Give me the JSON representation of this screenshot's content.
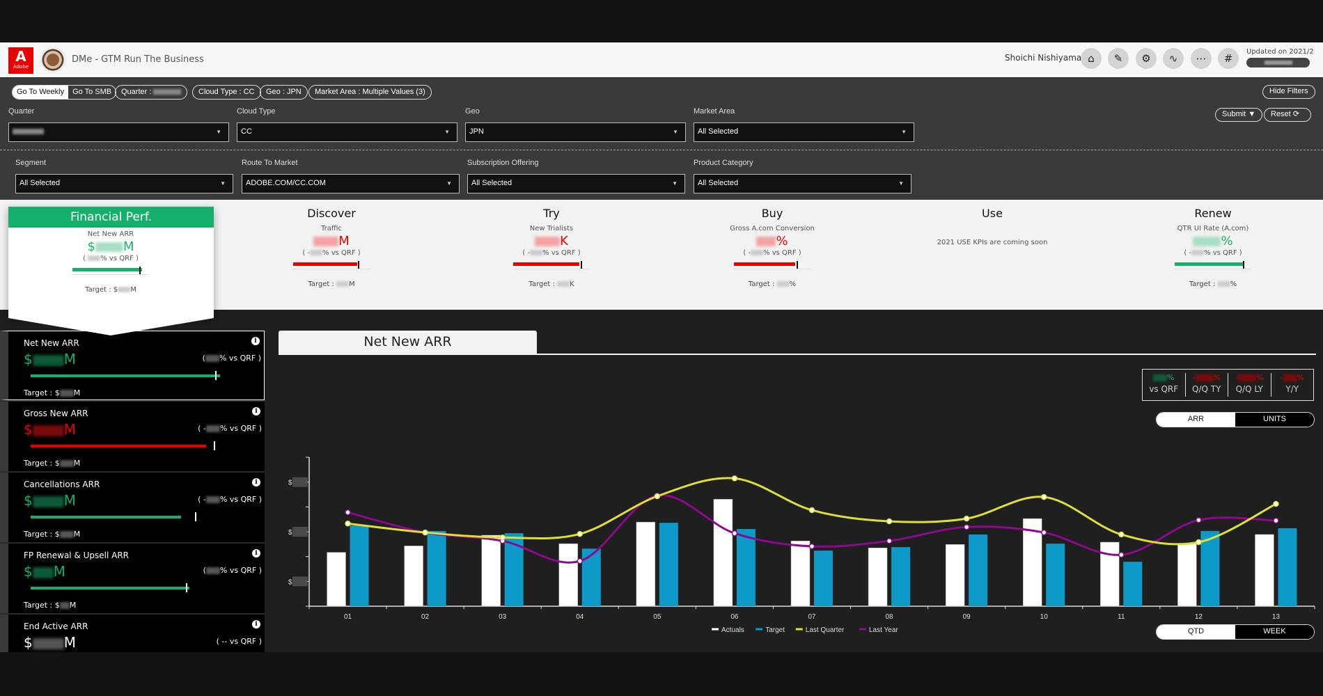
{
  "header": {
    "logo_label": "Adobe",
    "app_title": "DMe - GTM Run The Business",
    "user_name": "Shoichi Nishiyama",
    "icons": [
      "home-icon",
      "edit-icon",
      "filter-settings-icon",
      "pulse-icon",
      "workflow-icon",
      "slack-icon"
    ],
    "updated_label": "Updated on 2021/2"
  },
  "filters": {
    "chips": {
      "weekly": "Go To Weekly",
      "smb": "Go To SMB",
      "quarter": "Quarter : ",
      "cloud_type": "Cloud Type : CC",
      "geo": "Geo : JPN",
      "market_area": "Market Area : Multiple Values (3)"
    },
    "hide_filters": "Hide Filters",
    "submit": "Submit",
    "reset": "Reset",
    "row1": [
      {
        "label": "Quarter",
        "value": ""
      },
      {
        "label": "Cloud Type",
        "value": "CC"
      },
      {
        "label": "Geo",
        "value": "JPN"
      },
      {
        "label": "Market Area",
        "value": "All Selected"
      }
    ],
    "row2": [
      {
        "label": "Segment",
        "value": "All Selected"
      },
      {
        "label": "Route To Market",
        "value": "ADOBE.COM/CC.COM"
      },
      {
        "label": "Subscription Offering",
        "value": "All Selected"
      },
      {
        "label": "Product Category",
        "value": "All Selected"
      }
    ]
  },
  "kpis": {
    "financial": {
      "title": "Financial Perf.",
      "metric": "Net New ARR",
      "prefix": "$",
      "suffix": "M",
      "vs_prefix": "(",
      "vs_suffix": "% vs QRF )",
      "target_prefix": "Target : $",
      "target_suffix": "M",
      "progress": 0.97,
      "status": "good"
    },
    "discover": {
      "title": "Discover",
      "metric": "Traffic",
      "prefix": "",
      "suffix": "M",
      "vs_prefix": "( -",
      "vs_suffix": "% vs QRF )",
      "target_prefix": "Target : ",
      "target_suffix": "M",
      "progress": 0.93,
      "status": "bad"
    },
    "try": {
      "title": "Try",
      "metric": "New Trialists",
      "prefix": "",
      "suffix": "K",
      "vs_prefix": "( -",
      "vs_suffix": "% vs QRF )",
      "target_prefix": "Target : ",
      "target_suffix": "K",
      "progress": 0.95,
      "status": "bad"
    },
    "buy": {
      "title": "Buy",
      "metric": "Gross A.com Conversion",
      "prefix": "",
      "suffix": "%",
      "vs_prefix": "( -",
      "vs_suffix": "% vs QRF )",
      "target_prefix": "Target : ",
      "target_suffix": "%",
      "progress": 0.97,
      "status": "bad"
    },
    "use": {
      "title": "Use",
      "message": "2021 USE KPIs are coming soon"
    },
    "renew": {
      "title": "Renew",
      "metric": "QTR UI Rate (A.com)",
      "prefix": "",
      "suffix": "%",
      "vs_prefix": "( -",
      "vs_suffix": "% vs QRF )",
      "target_prefix": "Target : ",
      "target_suffix": "%",
      "progress": 1.0,
      "status": "good"
    }
  },
  "metrics": [
    {
      "title": "Net New ARR",
      "prefix": "$",
      "suffix": "M",
      "vs": "% vs QRF )",
      "vs_prefix": "(",
      "target": "Target : $",
      "target_suffix": "M",
      "status": "good",
      "progress": 1.0,
      "target_mark": 0.97,
      "active": true
    },
    {
      "title": "Gross New ARR",
      "prefix": "$",
      "suffix": "M",
      "vs": "% vs QRF )",
      "vs_prefix": "( -",
      "target": "Target : $",
      "target_suffix": "M",
      "status": "bad",
      "progress": 0.95,
      "target_mark": 1.0,
      "active": false
    },
    {
      "title": "Cancellations ARR",
      "prefix": "$",
      "suffix": "M",
      "vs": "% vs QRF )",
      "vs_prefix": "( -",
      "target": "Target : $",
      "target_suffix": "M",
      "status": "good",
      "progress": 0.92,
      "target_mark": 1.0,
      "active": false
    },
    {
      "title": "FP Renewal & Upsell ARR",
      "prefix": "$",
      "suffix": "M",
      "vs": "% vs QRF )",
      "vs_prefix": "(",
      "target": "Target : $",
      "target_suffix": "M",
      "status": "good",
      "progress": 1.0,
      "target_mark": 0.97,
      "active": false
    },
    {
      "title": "End Active ARR",
      "prefix": "$",
      "suffix": "M",
      "vs": "( -- vs QRF )",
      "vs_prefix": "",
      "target": "",
      "target_suffix": "",
      "status": "neutral",
      "active": false
    }
  ],
  "chart_panel": {
    "tab_title": "Net New ARR",
    "stats": [
      {
        "value_suffix": "%",
        "label": "vs QRF",
        "status": "good"
      },
      {
        "value_suffix": "%",
        "label": "Q/Q TY",
        "status": "bad"
      },
      {
        "value_suffix": "%",
        "label": "Q/Q LY",
        "status": "bad"
      },
      {
        "value_suffix": "%",
        "label": "Y/Y",
        "status": "bad"
      }
    ],
    "unit_toggle": {
      "options": [
        "ARR",
        "UNITS"
      ],
      "selected": "ARR"
    },
    "period_toggle": {
      "options": [
        "QTD",
        "WEEK"
      ],
      "selected": "QTD"
    }
  },
  "colors": {
    "good": "#16b06c",
    "bad": "#e60000",
    "actuals": "#ffffff",
    "target": "#0e9ac8",
    "last_quarter": "#e0e032",
    "last_year": "#8b0a8b"
  },
  "chart_data": {
    "type": "bar",
    "title": "Net New ARR",
    "xlabel": "",
    "ylabel": "",
    "y_tick_labels_obscured": true,
    "ylim": [
      0,
      6
    ],
    "categories": [
      "01",
      "02",
      "03",
      "04",
      "05",
      "06",
      "07",
      "08",
      "09",
      "10",
      "11",
      "12",
      "13"
    ],
    "series": [
      {
        "name": "Actuals",
        "type": "bar",
        "values": [
          2.17,
          2.43,
          2.86,
          2.52,
          3.39,
          4.31,
          2.63,
          2.35,
          2.49,
          3.53,
          2.58,
          2.52,
          2.89
        ]
      },
      {
        "name": "Target",
        "type": "bar",
        "values": [
          3.25,
          3.03,
          2.94,
          2.32,
          3.36,
          3.11,
          2.24,
          2.38,
          2.89,
          2.52,
          1.79,
          3.03,
          3.14
        ]
      },
      {
        "name": "Last Quarter",
        "type": "line",
        "values": [
          3.33,
          2.97,
          2.77,
          2.91,
          4.43,
          5.15,
          3.87,
          3.42,
          3.53,
          4.4,
          2.89,
          2.58,
          4.12
        ]
      },
      {
        "name": "Last Year",
        "type": "line",
        "values": [
          3.78,
          2.97,
          2.63,
          1.82,
          4.45,
          2.94,
          2.41,
          2.63,
          3.19,
          2.97,
          2.07,
          3.47,
          3.45
        ]
      }
    ],
    "legend": [
      "Actuals",
      "Target",
      "Last Quarter",
      "Last Year"
    ],
    "legend_position": "bottom",
    "grid": false
  }
}
